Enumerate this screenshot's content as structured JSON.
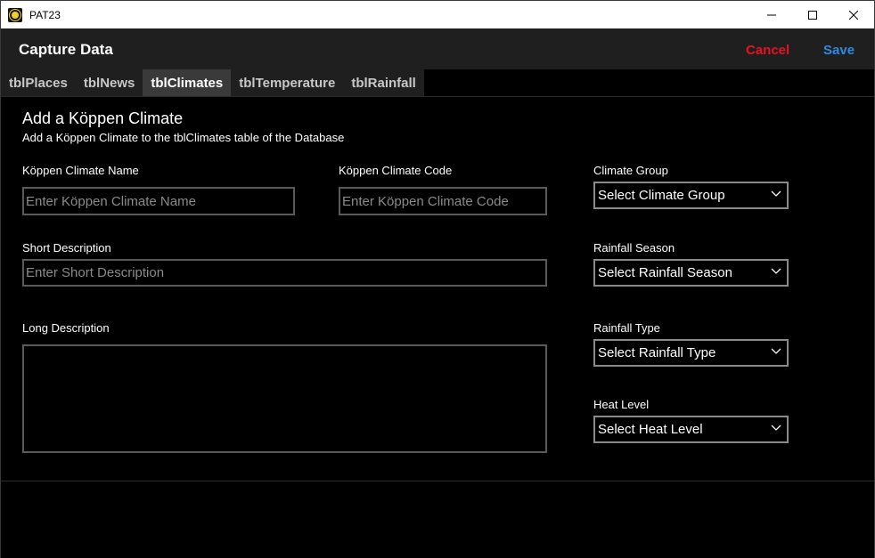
{
  "window": {
    "title": "PAT23",
    "icon": "sun-app-icon",
    "controls": [
      "minimize-icon",
      "maximize-icon",
      "close-icon"
    ]
  },
  "header": {
    "title": "Capture Data",
    "cancel_label": "Cancel",
    "save_label": "Save",
    "cancel_color": "#e81123",
    "save_color": "#2b8ae2"
  },
  "tabs": [
    {
      "label": "tblPlaces",
      "active": false
    },
    {
      "label": "tblNews",
      "active": false
    },
    {
      "label": "tblClimates",
      "active": true
    },
    {
      "label": "tblTemperature",
      "active": false
    },
    {
      "label": "tblRainfall",
      "active": false
    }
  ],
  "form": {
    "title": "Add a Köppen Climate",
    "subtitle": "Add a Köppen Climate to the tblClimates table of the Database",
    "name": {
      "label": "Köppen Climate Name",
      "placeholder": "Enter Köppen Climate Name",
      "value": ""
    },
    "code": {
      "label": "Köppen Climate Code",
      "placeholder": "Enter Köppen Climate Code",
      "value": ""
    },
    "short_description": {
      "label": "Short Description",
      "placeholder": "Enter Short Description",
      "value": ""
    },
    "long_description": {
      "label": "Long Description",
      "value": ""
    },
    "climate_group": {
      "label": "Climate Group",
      "selected": "Select Climate Group"
    },
    "rainfall_season": {
      "label": "Rainfall Season",
      "selected": "Select Rainfall Season"
    },
    "rainfall_type": {
      "label": "Rainfall Type",
      "selected": "Select Rainfall Type"
    },
    "heat_level": {
      "label": "Heat Level",
      "selected": "Select Heat Level"
    }
  }
}
